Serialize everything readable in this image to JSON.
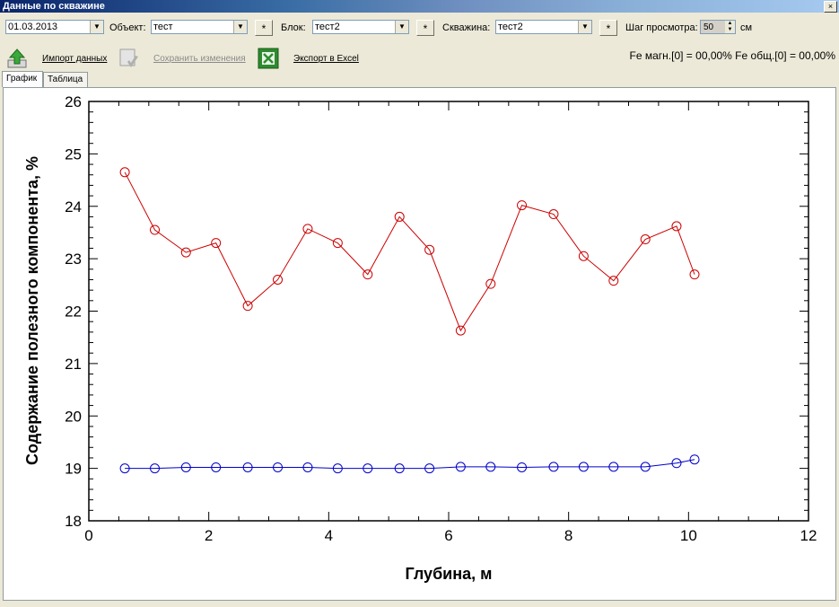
{
  "window": {
    "title": "Данные по скважине",
    "close": "×"
  },
  "toolbar": {
    "date": "01.03.2013",
    "object_label": "Объект:",
    "object_value": "тест",
    "block_label": "Блок:",
    "block_value": "тест2",
    "well_label": "Скважина:",
    "well_value": "тест2",
    "star": "*",
    "step_label": "Шаг просмотра:",
    "step_value": "50",
    "step_unit": "см",
    "import_label": "Импорт данных",
    "save_label": "Сохранить изменения",
    "export_label": "Экспорт в Excel",
    "status_text": "Fe магн.[0] = 00,00%  Fe общ.[0] = 00,00%"
  },
  "tabs": [
    {
      "label": "График",
      "active": true
    },
    {
      "label": "Таблица",
      "active": false
    }
  ],
  "colors": {
    "series_red": "#cc0000",
    "series_blue": "#0000cc"
  },
  "chart_data": {
    "type": "line",
    "xlabel": "Глубина, м",
    "ylabel": "Содержание полезного компонента, %",
    "xlim": [
      0,
      12
    ],
    "ylim": [
      18,
      26
    ],
    "xticks": [
      0,
      2,
      4,
      6,
      8,
      10,
      12
    ],
    "yticks": [
      18,
      19,
      20,
      21,
      22,
      23,
      24,
      25,
      26
    ],
    "grid": false,
    "series": [
      {
        "color": "#cc0000",
        "x": [
          0.6,
          1.1,
          1.62,
          2.12,
          2.65,
          3.15,
          3.65,
          4.15,
          4.65,
          5.18,
          5.68,
          6.2,
          6.7,
          7.22,
          7.75,
          8.25,
          8.75,
          9.28,
          9.8,
          10.1
        ],
        "y": [
          24.65,
          23.55,
          23.12,
          23.3,
          22.1,
          22.6,
          23.57,
          23.3,
          22.7,
          23.8,
          23.17,
          21.63,
          22.52,
          24.02,
          23.85,
          23.05,
          22.58,
          23.37,
          23.62,
          22.7
        ]
      },
      {
        "color": "#0000cc",
        "x": [
          0.6,
          1.1,
          1.62,
          2.12,
          2.65,
          3.15,
          3.65,
          4.15,
          4.65,
          5.18,
          5.68,
          6.2,
          6.7,
          7.22,
          7.75,
          8.25,
          8.75,
          9.28,
          9.8,
          10.1
        ],
        "y": [
          19.0,
          19.0,
          19.02,
          19.02,
          19.02,
          19.02,
          19.02,
          19.0,
          19.0,
          19.0,
          19.0,
          19.03,
          19.03,
          19.02,
          19.03,
          19.03,
          19.03,
          19.03,
          19.1,
          19.17
        ]
      }
    ]
  }
}
